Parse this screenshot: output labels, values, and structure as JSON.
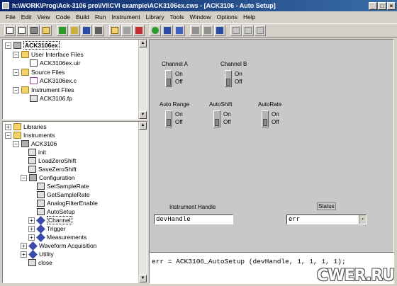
{
  "window": {
    "title": "h:\\WORK\\Prog\\Ack-3106 pro\\IVI\\CVI example\\ACK3106ex.cws - [ACK3106 - Auto Setup]"
  },
  "menu": [
    "File",
    "Edit",
    "View",
    "Code",
    "Build",
    "Run",
    "Instrument",
    "Library",
    "Tools",
    "Window",
    "Options",
    "Help"
  ],
  "toolbar": {
    "icons": [
      "new-icon",
      "open-icon",
      "save-icon",
      "folder-icon",
      "run-icon",
      "build-icon",
      "debug-icon",
      "breakpoint-icon",
      "print-icon",
      "cut-icon",
      "copy-icon",
      "paste-icon",
      "find-icon",
      "replace-icon",
      "bookmark-icon",
      "function-panel-icon",
      "help-icon",
      "tile-icon",
      "cascade-icon",
      "close-icon"
    ],
    "colors": {
      "green": "#2a9a2a",
      "blue": "#2a4aa8",
      "gray": "#a0a0a0"
    }
  },
  "project_tree": {
    "root": "ACK3106ex",
    "items": [
      {
        "label": "User Interface Files",
        "kind": "folder"
      },
      {
        "label": "ACK3106ex.uir",
        "kind": "file"
      },
      {
        "label": "Source Files",
        "kind": "folder"
      },
      {
        "label": "ACK3106ex.c",
        "kind": "file"
      },
      {
        "label": "Instrument Files",
        "kind": "folder"
      },
      {
        "label": "ACK3106.fp",
        "kind": "file"
      }
    ]
  },
  "library_tree": {
    "items": [
      "Libraries",
      "Instruments",
      "ACK3106",
      "init",
      "LoadZeroShift",
      "SaveZeroShift",
      "Configuration",
      "SetSampleRate",
      "GetSampleRate",
      "AnalogFilterEnable",
      "AutoSetup",
      "Channel",
      "Trigger",
      "Measurements",
      "Waveform Acquisition",
      "Utility",
      "close"
    ]
  },
  "panel": {
    "switches": [
      {
        "label": "Channel A",
        "on": "On",
        "off": "Off"
      },
      {
        "label": "Channel B",
        "on": "On",
        "off": "Off"
      },
      {
        "label": "Auto Range",
        "on": "On",
        "off": "Off"
      },
      {
        "label": "AutoShift",
        "on": "On",
        "off": "Off"
      },
      {
        "label": "AutoRate",
        "on": "On",
        "off": "Off"
      }
    ],
    "instrument_handle": {
      "label": "Instrument Handle",
      "value": "devHandle"
    },
    "status": {
      "label": "Status",
      "value": "err"
    }
  },
  "code_line": "err = ACK3106_AutoSetup (devHandle, 1, 1, 1, 1);",
  "watermark": "CWER.RU"
}
